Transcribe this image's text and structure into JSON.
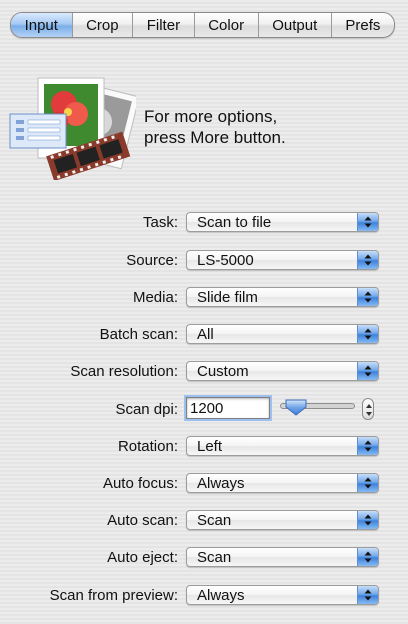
{
  "tabs": [
    "Input",
    "Crop",
    "Filter",
    "Color",
    "Output",
    "Prefs"
  ],
  "active_tab": "Input",
  "hero": {
    "line1": "For more options,",
    "line2": "press More button."
  },
  "fields": {
    "task": {
      "label": "Task:",
      "value": "Scan to file"
    },
    "source": {
      "label": "Source:",
      "value": "LS-5000"
    },
    "media": {
      "label": "Media:",
      "value": "Slide film"
    },
    "batch_scan": {
      "label": "Batch scan:",
      "value": "All"
    },
    "scan_resolution": {
      "label": "Scan resolution:",
      "value": "Custom"
    },
    "scan_dpi": {
      "label": "Scan dpi:",
      "value": "1200"
    },
    "rotation": {
      "label": "Rotation:",
      "value": "Left"
    },
    "auto_focus": {
      "label": "Auto focus:",
      "value": "Always"
    },
    "auto_scan": {
      "label": "Auto scan:",
      "value": "Scan"
    },
    "auto_eject": {
      "label": "Auto eject:",
      "value": "Scan"
    },
    "scan_from_preview": {
      "label": "Scan from preview:",
      "value": "Always"
    }
  },
  "scan_dpi_slider_fraction": 0.1,
  "colors": {
    "accent_blue": "#3f82db",
    "active_tab": "#a6c9f3"
  },
  "icons": {
    "hero": "scanner-photo-film-icon",
    "popup": "updown-arrows-icon",
    "stepper": "stepper-icon"
  }
}
